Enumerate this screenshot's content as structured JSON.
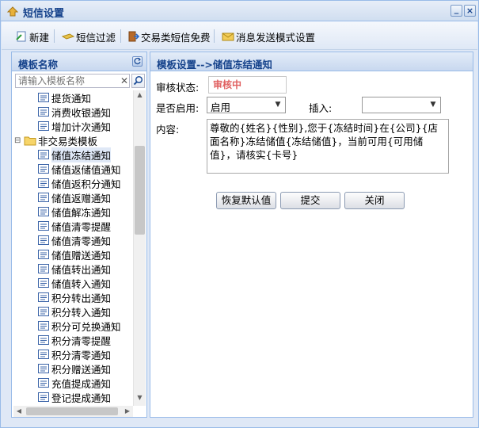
{
  "window": {
    "title": "短信设置"
  },
  "toolbar": {
    "new_label": "新建",
    "filter_label": "短信过滤",
    "free_label": "交易类短信免费",
    "mode_label": "消息发送模式设置"
  },
  "left": {
    "header": "模板名称",
    "search_placeholder": "请输入模板名称",
    "items_before": [
      "提货通知",
      "消费收银通知",
      "增加计次通知"
    ],
    "folder": "非交易类模板",
    "items_after": [
      "储值冻结通知",
      "储值返储值通知",
      "储值返积分通知",
      "储值返赠通知",
      "储值解冻通知",
      "储值清零提醒",
      "储值清零通知",
      "储值赠送通知",
      "储值转出通知",
      "储值转入通知",
      "积分转出通知",
      "积分转入通知",
      "积分可兑换通知",
      "积分清零提醒",
      "积分清零通知",
      "积分赠送通知",
      "充值提成通知",
      "登记提成通知"
    ]
  },
  "right": {
    "header": "模板设置-->储值冻结通知",
    "status_label": "审核状态:",
    "status_value": "审核中",
    "enabled_label": "是否启用:",
    "enabled_value": "启用",
    "insert_label": "插入:",
    "insert_value": "",
    "content_label": "内容:",
    "content_value": "尊敬的{姓名}{性别},您于{冻结时间}在{公司}{店面名称}冻结储值{冻结储值}，当前可用{可用储值}，请核实{卡号}",
    "restore_button": "恢复默认值",
    "submit_button": "提交",
    "close_button": "关闭"
  },
  "colors": {
    "header_text": "#15428b",
    "status_text": "#e06060",
    "panel_border": "#99bbe8"
  }
}
